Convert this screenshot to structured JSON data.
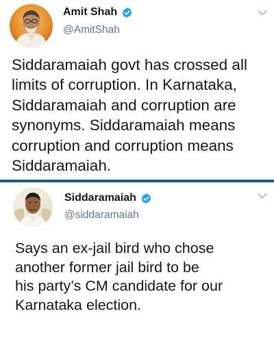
{
  "tweets": [
    {
      "display_name": "Amit Shah",
      "handle": "@AmitShah",
      "verified": true,
      "text": "Siddaramaiah govt has crossed all\nlimits of corruption. In Karnataka,\nSiddaramaiah and corruption are\nsynonyms. Siddaramaiah means\ncorruption and corruption means\nSiddaramaiah."
    },
    {
      "display_name": "Siddaramaiah",
      "handle": "@siddaramaiah",
      "verified": true,
      "text": "Says an ex-jail bird who chose\nanother former jail bird to be\nhis party’s CM candidate for our\nKarnataka election."
    }
  ],
  "colors": {
    "verified_badge": "#1da1f2",
    "divider": "#1e5a86",
    "handle": "#657786",
    "text": "#14171a"
  },
  "icons": {
    "verified": "verified-badge-icon",
    "menu": "chevron-down-icon"
  }
}
